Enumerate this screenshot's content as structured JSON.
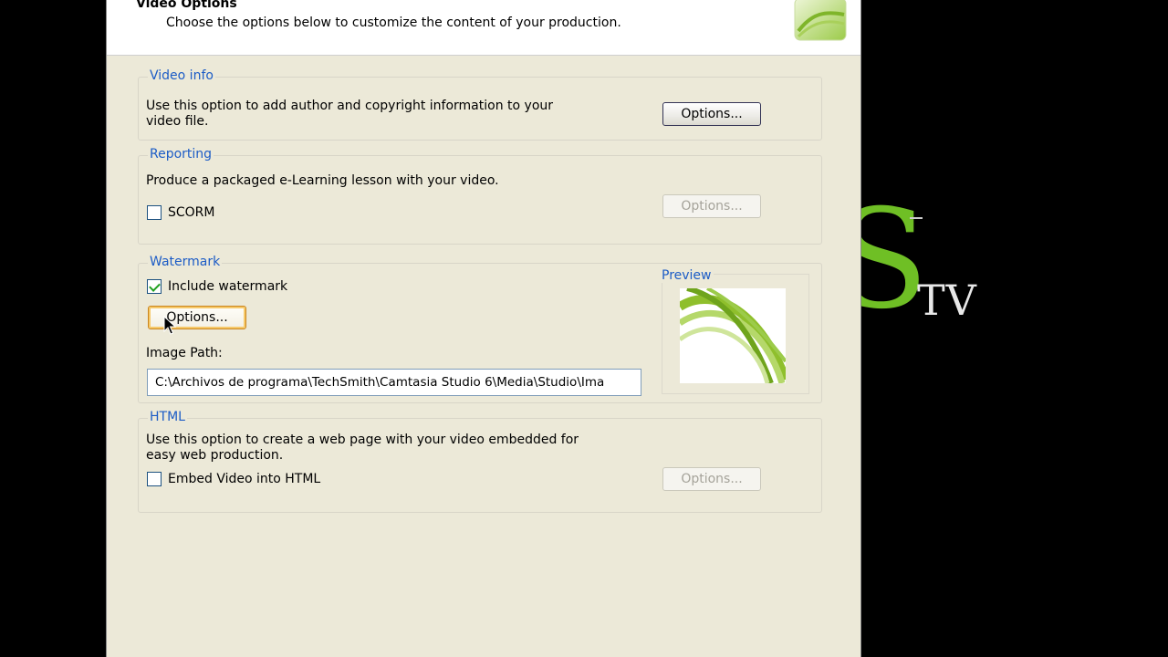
{
  "header": {
    "title": "Video Options",
    "subtitle": "Choose the options below to customize the content of your production."
  },
  "video_info": {
    "title": "Video info",
    "description_line1": "Use this option to add author and copyright information to your",
    "description_line2": "video file.",
    "options_label": "Options..."
  },
  "reporting": {
    "title": "Reporting",
    "description": "Produce a packaged  e-Learning lesson with your video.",
    "scorm_label": "SCORM",
    "scorm_checked": false,
    "options_label": "Options..."
  },
  "watermark": {
    "title": "Watermark",
    "include_label": "Include watermark",
    "include_checked": true,
    "options_label": "Options...",
    "image_path_label": "Image Path:",
    "image_path_value": "C:\\Archivos de programa\\TechSmith\\Camtasia Studio 6\\Media\\Studio\\Ima",
    "preview_label": "Preview"
  },
  "html": {
    "title": "HTML",
    "description_line1": "Use this option to create a web page with your video embedded for",
    "description_line2": "easy web production.",
    "embed_label": "Embed Video into HTML",
    "embed_checked": false,
    "options_label": "Options..."
  },
  "brand": {
    "letter": "S",
    "suffix": "TV"
  },
  "colors": {
    "accent_green": "#6fbf25",
    "group_title_blue": "#1c5cc6",
    "dialog_bg": "#ece9d8"
  }
}
